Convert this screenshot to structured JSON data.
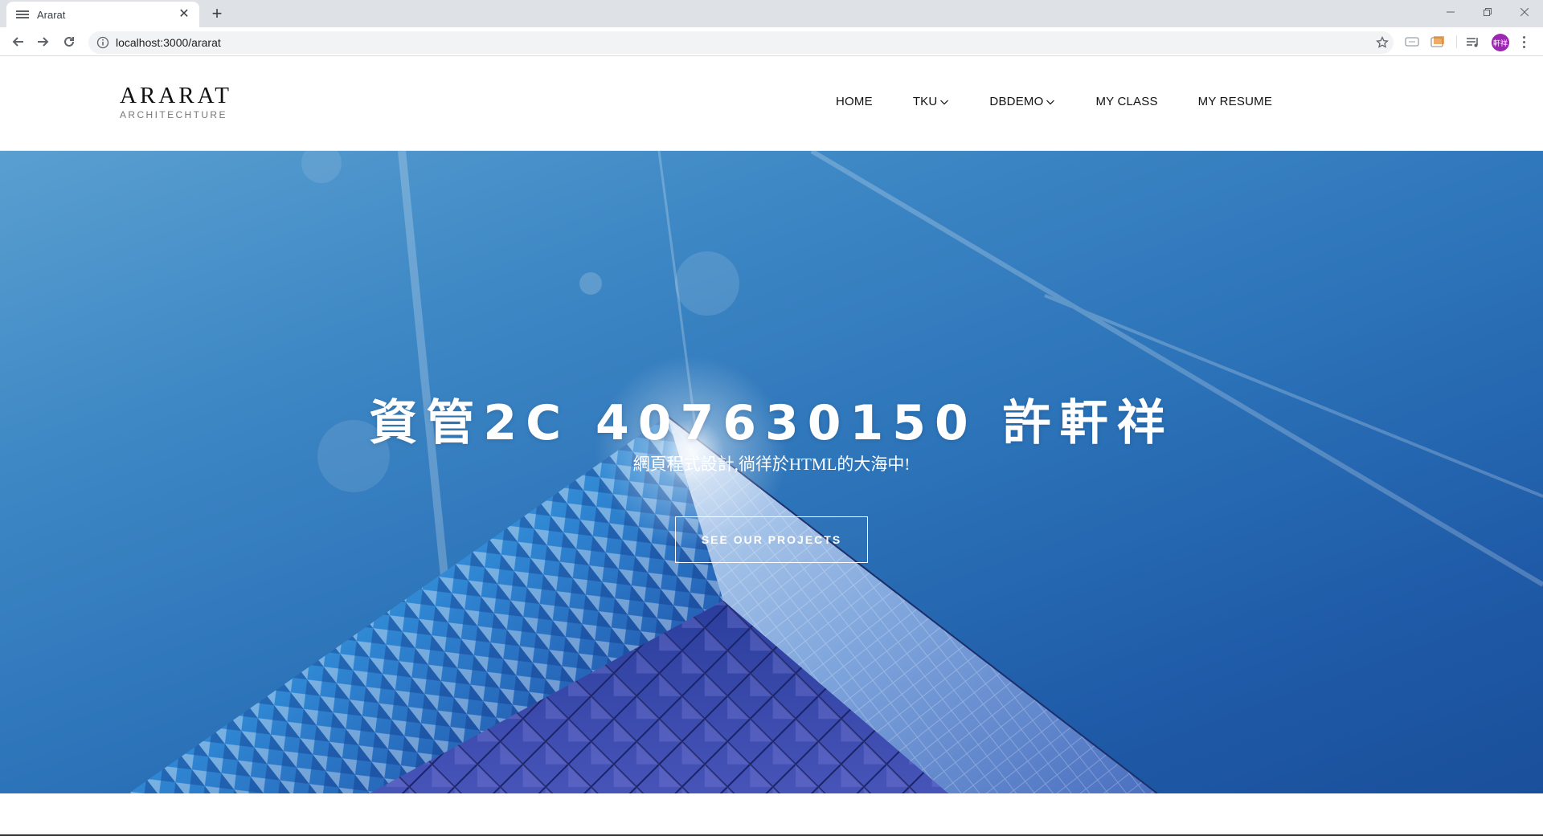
{
  "browser": {
    "tab_title": "Ararat",
    "url": "localhost:3000/ararat",
    "profile_label": "軒祥"
  },
  "site": {
    "brand": {
      "name": "ARARAT",
      "subtitle": "ARCHITECHTURE"
    },
    "nav": {
      "items": [
        {
          "label": "HOME",
          "dropdown": false
        },
        {
          "label": "TKU",
          "dropdown": true
        },
        {
          "label": "DBDEMO",
          "dropdown": true
        },
        {
          "label": "MY CLASS",
          "dropdown": false
        },
        {
          "label": "MY RESUME",
          "dropdown": false
        }
      ]
    },
    "hero": {
      "title": "資管2C 407630150 許軒祥",
      "subtitle": "網頁程式設計,徜徉於HTML的大海中!",
      "button_label": "SEE OUR PROJECTS"
    }
  },
  "colors": {
    "sky_top": "#5a9fd0",
    "sky_bottom": "#1a4f9b",
    "avatar": "#9c27b0"
  }
}
